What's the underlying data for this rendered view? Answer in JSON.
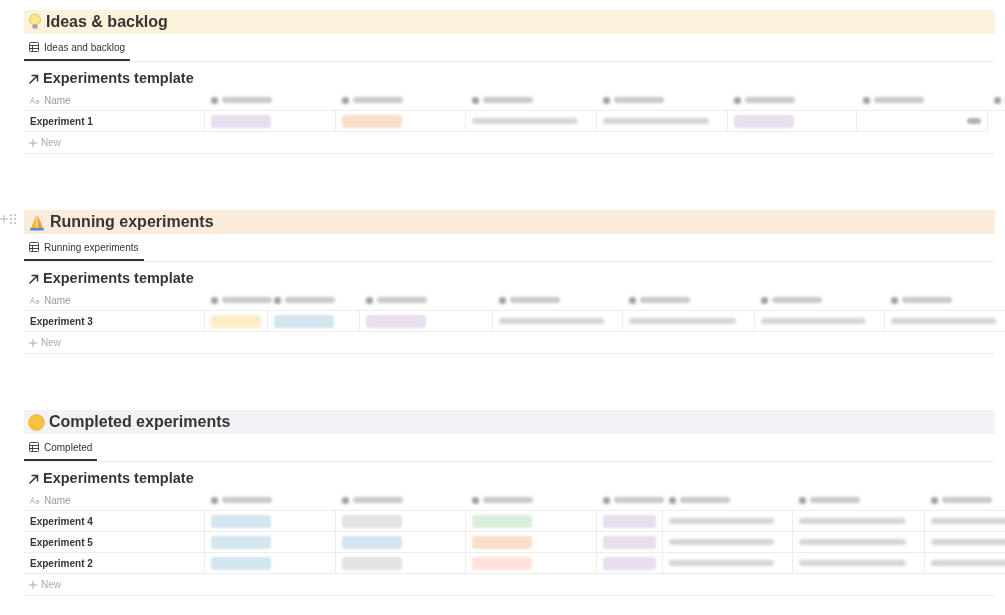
{
  "sections": [
    {
      "title": "Ideas & backlog",
      "kind": "bulb",
      "color": "#fbf3db",
      "handle": false,
      "view_tab": {
        "label": "Ideas and backlog",
        "selected": true
      },
      "table_title": "Experiments template",
      "columns": [
        {
          "kind": "name",
          "label": "Name"
        },
        {
          "kind": "blurred"
        },
        {
          "kind": "blurred"
        },
        {
          "kind": "blurred"
        },
        {
          "kind": "blurred"
        },
        {
          "kind": "blurred"
        },
        {
          "kind": "blurred"
        },
        {
          "kind": "blurred"
        }
      ],
      "rows": [
        {
          "name": "Experiment 1",
          "cells": [
            {
              "kind": "pill",
              "color": "#e8deee"
            },
            {
              "kind": "pill",
              "color": "#fadec9"
            },
            {
              "kind": "text"
            },
            {
              "kind": "text"
            },
            {
              "kind": "pill",
              "color": "#e8deee"
            },
            {
              "kind": "number"
            }
          ]
        }
      ],
      "new_label": "New"
    },
    {
      "title": "Running experiments",
      "kind": "hands",
      "color": "#fbecdd",
      "handle": true,
      "view_tab": {
        "label": "Running experiments",
        "selected": true
      },
      "table_title": "Experiments template",
      "columns": [
        {
          "kind": "name",
          "label": "Name"
        },
        {
          "kind": "blurred"
        },
        {
          "kind": "blurred"
        },
        {
          "kind": "blurred"
        },
        {
          "kind": "blurred"
        },
        {
          "kind": "blurred"
        },
        {
          "kind": "blurred"
        },
        {
          "kind": "blurred"
        }
      ],
      "rows": [
        {
          "name": "Experiment 3",
          "cells": [
            {
              "kind": "pill",
              "color": "#fdecc8"
            },
            {
              "kind": "pill",
              "color": "#d3e5ef"
            },
            {
              "kind": "pill",
              "color": "#e8deee"
            },
            {
              "kind": "text"
            },
            {
              "kind": "text"
            },
            {
              "kind": "text"
            },
            {
              "kind": "text"
            }
          ]
        }
      ],
      "new_label": "New"
    },
    {
      "title": "Completed experiments",
      "kind": "face",
      "color": "#f4f2f7",
      "handle": false,
      "view_tab": {
        "label": "Completed",
        "selected": true
      },
      "table_title": "Experiments template",
      "columns": [
        {
          "kind": "name",
          "label": "Name"
        },
        {
          "kind": "blurred"
        },
        {
          "kind": "blurred"
        },
        {
          "kind": "blurred"
        },
        {
          "kind": "blurred"
        },
        {
          "kind": "blurred"
        },
        {
          "kind": "blurred"
        },
        {
          "kind": "blurred"
        }
      ],
      "rows": [
        {
          "name": "Experiment 4",
          "cells": [
            {
              "kind": "pill",
              "color": "#d3e5ef"
            },
            {
              "kind": "pill",
              "color": "#e3e2e0"
            },
            {
              "kind": "pill",
              "color": "#dbeddb"
            },
            {
              "kind": "pill",
              "color": "#e8deee"
            },
            {
              "kind": "text"
            },
            {
              "kind": "text"
            },
            {
              "kind": "text"
            }
          ]
        },
        {
          "name": "Experiment 5",
          "cells": [
            {
              "kind": "pill",
              "color": "#d3e5ef"
            },
            {
              "kind": "pill",
              "color": "#d3e5ef"
            },
            {
              "kind": "pill",
              "color": "#fadec9"
            },
            {
              "kind": "pill",
              "color": "#e8deee"
            },
            {
              "kind": "text"
            },
            {
              "kind": "text"
            },
            {
              "kind": "text"
            }
          ]
        },
        {
          "name": "Experiment 2",
          "cells": [
            {
              "kind": "pill",
              "color": "#d3e5ef"
            },
            {
              "kind": "pill",
              "color": "#e3e2e0"
            },
            {
              "kind": "pill",
              "color": "#ffe2dd"
            },
            {
              "kind": "pill",
              "color": "#e8deee"
            },
            {
              "kind": "text"
            },
            {
              "kind": "text"
            },
            {
              "kind": "text"
            }
          ]
        }
      ],
      "new_label": "New"
    }
  ]
}
